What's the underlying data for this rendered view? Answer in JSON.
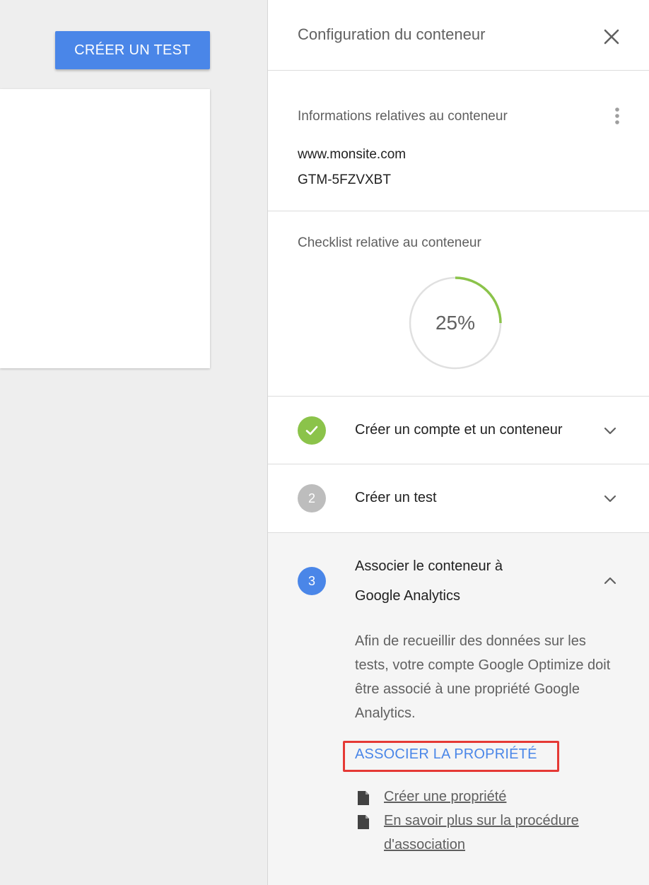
{
  "left": {
    "create_test_label": "CRÉER UN TEST"
  },
  "panel": {
    "title": "Configuration du conteneur",
    "info": {
      "label": "Informations relatives au conteneur",
      "domain": "www.monsite.com",
      "container_id": "GTM-5FZVXBT"
    },
    "checklist": {
      "label": "Checklist relative au conteneur",
      "progress_text": "25%",
      "progress_fraction": 0.25,
      "progress_color": "#8bc34a",
      "track_color": "#e0e0e0"
    },
    "steps": [
      {
        "badge": "✓",
        "title": "Créer un compte et un conteneur",
        "state": "done",
        "color": "#8bc34a"
      },
      {
        "badge": "2",
        "title": "Créer un test",
        "state": "pending",
        "color": "#bdbdbd"
      },
      {
        "badge": "3",
        "title_line1": "Associer le conteneur à",
        "title_line2": "Google Analytics",
        "state": "active",
        "color": "#4a86e8",
        "description": "Afin de recueillir des données sur les tests, votre compte Google Optimize doit être associé à une propriété Google Analytics.",
        "action_label": "ASSOCIER LA PROPRIÉTÉ",
        "links": [
          {
            "icon": "document-icon",
            "label": "Créer une propriété"
          },
          {
            "icon": "document-icon",
            "label_line1": "En savoir plus sur la procédure",
            "label_line2": "d'association"
          }
        ]
      }
    ]
  },
  "colors": {
    "accent": "#4a86e8",
    "highlight_border": "#e53935"
  }
}
